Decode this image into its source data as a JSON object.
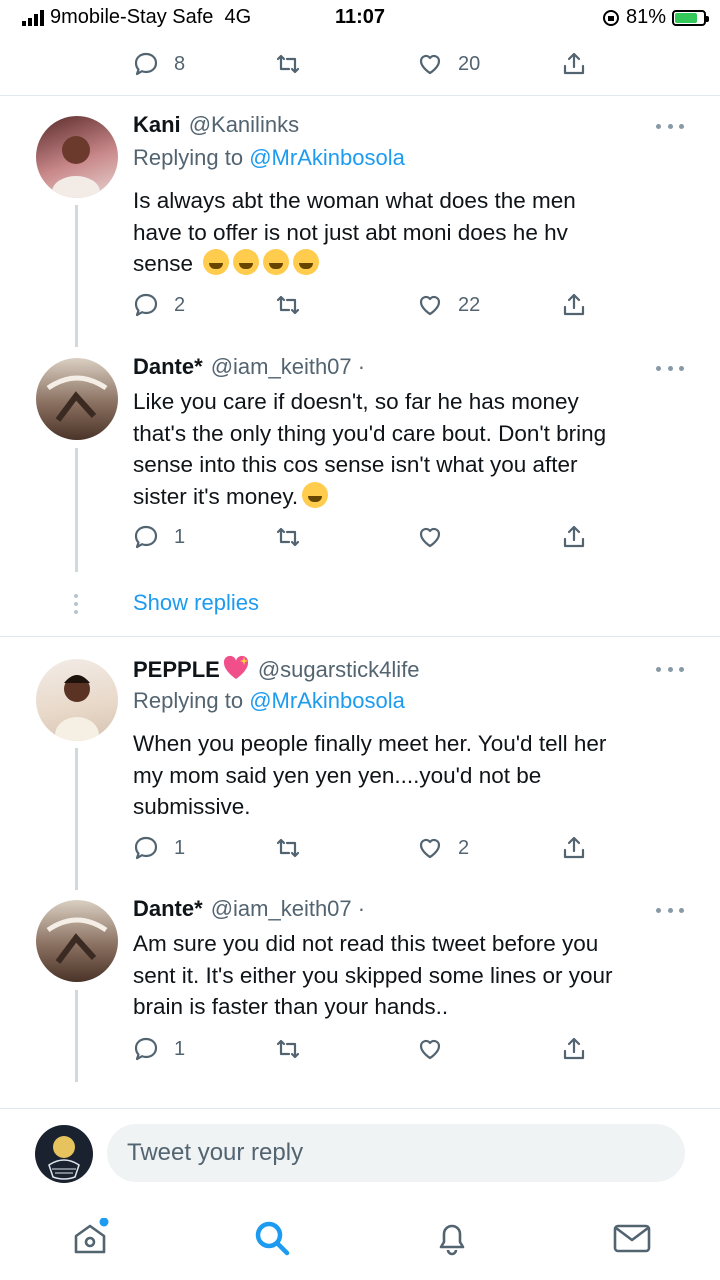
{
  "status_bar": {
    "carrier": "9mobile-Stay Safe",
    "network": "4G",
    "time": "11:07",
    "battery": "81%",
    "battery_level": 0.81
  },
  "top_actions": {
    "reply_count": "8",
    "like_count": "20"
  },
  "replies": [
    {
      "name": "Kani",
      "handle": "@Kanilinks",
      "replying_to_prefix": "Replying to",
      "replying_to": "@MrAkinbosola",
      "text_lines": [
        "Is always abt the woman what does the men",
        "have to offer is not just abt moni does he hv",
        "sense"
      ],
      "reply_count": "2",
      "like_count": "22"
    },
    {
      "name": "Dante*",
      "handle": "@iam_keith07 ·",
      "text_lines": [
        "Like you care if doesn't, so far he has money",
        "that's the only thing you'd care bout. Don't bring",
        "sense into this cos sense isn't what you after",
        "sister it's money."
      ],
      "reply_count": "1",
      "like_count": ""
    },
    {
      "name": "PEPPLE",
      "handle": "@sugarstick4life",
      "replying_to_prefix": "Replying to",
      "replying_to": "@MrAkinbosola",
      "text_lines": [
        "When you people finally meet her. You'd tell her",
        "my mom said yen yen yen....you'd not be",
        "submissive."
      ],
      "reply_count": "1",
      "like_count": "2"
    },
    {
      "name": "Dante*",
      "handle": "@iam_keith07 ·",
      "text_lines": [
        "Am sure you did not read this tweet before you",
        "sent it. It's either you skipped some lines or your",
        "brain is faster than your hands.."
      ],
      "reply_count": "1",
      "like_count": ""
    }
  ],
  "show_replies": "Show replies",
  "compose": {
    "placeholder": "Tweet your reply"
  },
  "tabbar": [
    "home-icon",
    "search-icon",
    "notifications-icon",
    "messages-icon"
  ],
  "colors": {
    "accent": "#1d9bf0",
    "muted": "#536471",
    "divider": "#e1e8ed"
  }
}
